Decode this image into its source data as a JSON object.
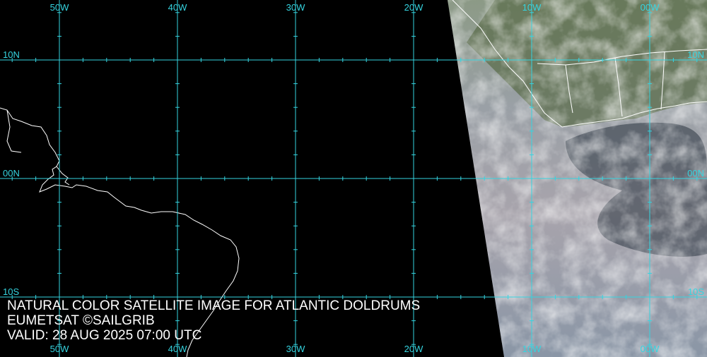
{
  "map": {
    "graticule_color": "#35d4e0",
    "coast_color": "#ffffff",
    "ocean_color": "#000000",
    "longitudes": [
      {
        "label": "50W",
        "value": -50
      },
      {
        "label": "40W",
        "value": -40
      },
      {
        "label": "30W",
        "value": -30
      },
      {
        "label": "20W",
        "value": -20
      },
      {
        "label": "10W",
        "value": -10
      },
      {
        "label": "00W",
        "value": 0
      }
    ],
    "latitudes": [
      {
        "label": "10N",
        "value": 10
      },
      {
        "label": "00N",
        "value": 0
      },
      {
        "label": "10S",
        "value": -10
      }
    ]
  },
  "caption": {
    "line1": "NATURAL COLOR SATELLITE IMAGE FOR ATLANTIC DOLDRUMS",
    "line2": "EUMETSAT ©SAILGRIB",
    "line3": "VALID:  28 AUG 2025 07:00 UTC"
  }
}
